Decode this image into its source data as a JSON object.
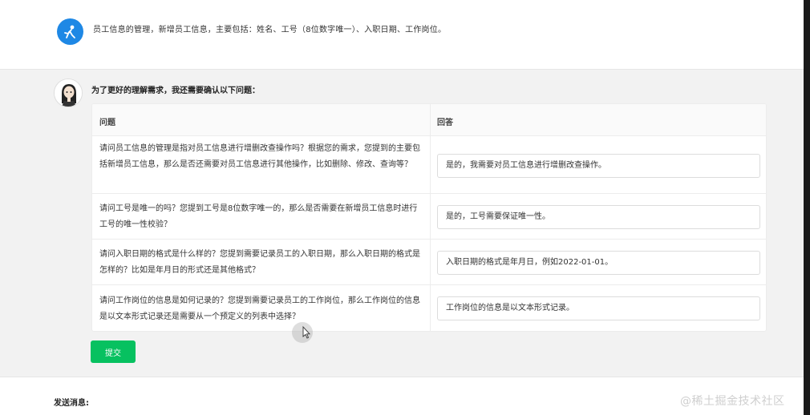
{
  "user_message": {
    "text": "员工信息的管理，新增员工信息，主要包括：姓名、工号（8位数字唯一）、入职日期、工作岗位。",
    "avatar_icon": "user-avatar-icon"
  },
  "bot": {
    "avatar_icon": "assistant-avatar-icon",
    "title": "为了更好的理解需求，我还需要确认以下问题："
  },
  "table": {
    "headers": {
      "question": "问题",
      "answer": "回答"
    },
    "rows": [
      {
        "question": "请问员工信息的管理是指对员工信息进行增删改查操作吗？根据您的需求，您提到的主要包括新增员工信息，那么是否还需要对员工信息进行其他操作，比如删除、修改、查询等？",
        "answer": "是的，我需要对员工信息进行增删改查操作。"
      },
      {
        "question": "请问工号是唯一的吗？您提到工号是8位数字唯一的，那么是否需要在新增员工信息时进行工号的唯一性校验？",
        "answer": "是的，工号需要保证唯一性。"
      },
      {
        "question": "请问入职日期的格式是什么样的？您提到需要记录员工的入职日期，那么入职日期的格式是怎样的？比如是年月日的形式还是其他格式？",
        "answer": "入职日期的格式是年月日，例如2022-01-01。"
      },
      {
        "question": "请问工作岗位的信息是如何记录的？您提到需要记录员工的工作岗位，那么工作岗位的信息是以文本形式记录还是需要从一个预定义的列表中选择？",
        "answer": "工作岗位的信息是以文本形式记录。"
      }
    ]
  },
  "submit_label": "提交",
  "send_label": "发送消息:",
  "watermark": "@稀土掘金技术社区",
  "colors": {
    "accent": "#07c160",
    "user_avatar": "#1e88e5"
  }
}
